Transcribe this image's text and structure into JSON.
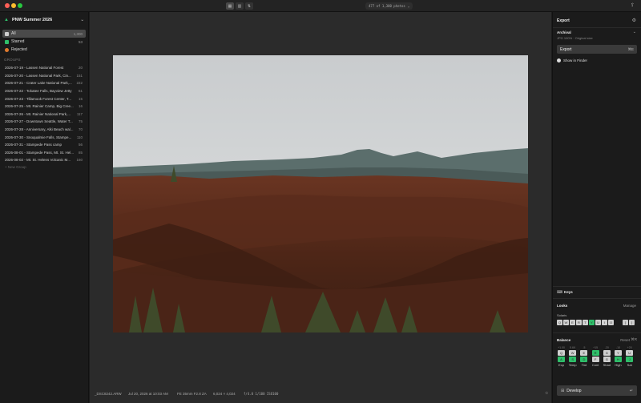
{
  "topbar": {
    "view_icons": [
      "grid-view-icon",
      "compare-view-icon",
      "rotate-icon"
    ],
    "photo_count": "477 of 1,300 photos",
    "share_icon": "share-icon"
  },
  "library": {
    "name": "PNW Summer 2026",
    "filters": [
      {
        "label": "All",
        "count": "1,300",
        "icon": "all-icon",
        "color": "#cfcfcf"
      },
      {
        "label": "Starred",
        "count": "53",
        "icon": "star-icon",
        "color": "#2fbf6a"
      },
      {
        "label": "Rejected",
        "count": "",
        "icon": "reject-icon",
        "color": "#e07a2e"
      }
    ],
    "groups_heading": "GROUPS",
    "groups": [
      {
        "label": "2026-07-19 - Lassen National Forest",
        "count": "20"
      },
      {
        "label": "2026-07-20 - Lassen National Park, Cin...",
        "count": "151"
      },
      {
        "label": "2026-07-21 - Crater Lake National Park,...",
        "count": "222"
      },
      {
        "label": "2026-07-22 - Tokatee Falls, Bayview Jetty",
        "count": "61"
      },
      {
        "label": "2026-07-23 - Tillamook Forest Center, T...",
        "count": "15"
      },
      {
        "label": "2026-07-25 - Mt. Rainier Camp, Big Cree...",
        "count": "16"
      },
      {
        "label": "2026-07-26 - Mt. Rainier National Park,...",
        "count": "117"
      },
      {
        "label": "2026-07-27 - Downtown Seattle, Water T...",
        "count": "75"
      },
      {
        "label": "2026-07-28 - Anniversary, Alki Beach wal...",
        "count": "70"
      },
      {
        "label": "2026-07-30 - Snoqualmie Falls, Stampe...",
        "count": "110"
      },
      {
        "label": "2026-07-31 - Stampede Pass camp",
        "count": "56"
      },
      {
        "label": "2026-08-01 - Stampede Pass, Mt. St. Hel...",
        "count": "85"
      },
      {
        "label": "2026-08-02 - Mt. St. Helens Volcanic M...",
        "count": "160"
      }
    ],
    "new_group": "New Group"
  },
  "statusbar": {
    "filename": "_DSC8242.ARW",
    "date": "Jul 20, 2026 at 10:03 AM",
    "lens": "FE 35mm F2.8 ZA",
    "dimensions": "6,024 × 4,024",
    "exposure": "f/4.0  1/100  ISO100",
    "rating_stars": 5,
    "star_char": "☆"
  },
  "export": {
    "heading": "Export",
    "preset_name": "Archival",
    "preset_desc": "JPG 100% · Original size",
    "button_label": "Export",
    "button_shortcut": "⌘E",
    "show_in_finder": "Show in Finder"
  },
  "keys": {
    "heading": "Keys"
  },
  "looks": {
    "heading": "Looks",
    "manage": "Manage",
    "preset_name": "Solaris",
    "keys": [
      "Q",
      "W",
      "E",
      "R",
      "T",
      "Y",
      "U",
      "I",
      "O"
    ],
    "active_index": 5,
    "accent": "#2fbf6a"
  },
  "balance": {
    "heading": "Balance",
    "reset": "Reset",
    "columns": [
      {
        "value": "+1.00",
        "top": "Q",
        "bottom": "A",
        "label": "Exp",
        "active_top": false,
        "active_bottom": true
      },
      {
        "value": "5.6K",
        "top": "W",
        "bottom": "S",
        "label": "Temp",
        "active_top": false,
        "active_bottom": true
      },
      {
        "value": "-5",
        "top": "E",
        "bottom": "D",
        "label": "Tint",
        "active_top": false,
        "active_bottom": true
      },
      {
        "value": "+15",
        "top": "R",
        "bottom": "F",
        "label": "Cont",
        "active_top": true,
        "active_bottom": false
      },
      {
        "value": "-20",
        "top": "G",
        "bottom": "G",
        "label": "Shad",
        "active_top": false,
        "active_bottom": false
      },
      {
        "value": "-10",
        "top": "Y",
        "bottom": "H",
        "label": "High",
        "active_top": false,
        "active_bottom": true
      },
      {
        "value": "+20",
        "top": "U",
        "bottom": "J",
        "label": "Sat",
        "active_top": false,
        "active_bottom": true
      }
    ]
  },
  "develop": {
    "label": "Develop",
    "shortcut": "↵"
  }
}
